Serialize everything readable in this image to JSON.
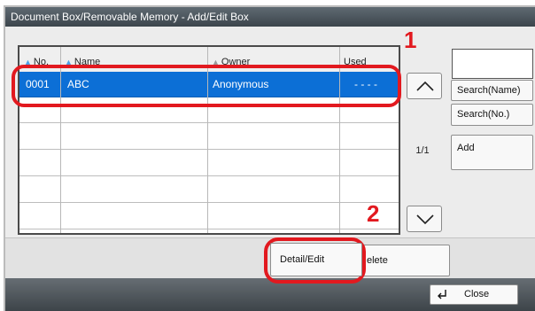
{
  "window": {
    "title": "Document Box/Removable Memory - Add/Edit Box"
  },
  "table": {
    "columns": [
      {
        "label": "No.",
        "sort_icon": "triangle-up-icon"
      },
      {
        "label": "Name",
        "sort_icon": "triangle-up-icon"
      },
      {
        "label": "Owner",
        "sort_icon": "triangle-up-icon"
      },
      {
        "label": "Used"
      }
    ],
    "rows": [
      {
        "no": "0001",
        "name": "ABC",
        "owner": "Anonymous",
        "used": "- - - -",
        "selected": true
      }
    ],
    "empty_rows": 5
  },
  "scroll": {
    "up_icon": "chevron-up-icon",
    "down_icon": "chevron-down-icon",
    "page_indicator": "1/1"
  },
  "side_panel": {
    "search_value": "",
    "search_name_label": "Search(Name)",
    "search_no_label": "Search(No.)",
    "add_label": "Add"
  },
  "actions": {
    "detail_edit_label": "Detail/Edit",
    "delete_label": "elete"
  },
  "footer": {
    "close_icon": "return-arrow-icon",
    "close_label": "Close"
  },
  "callouts": [
    "1",
    "2"
  ],
  "colors": {
    "selection": "#0c6fd6",
    "callout": "#e2191f",
    "title_bar": "#4a545b"
  }
}
